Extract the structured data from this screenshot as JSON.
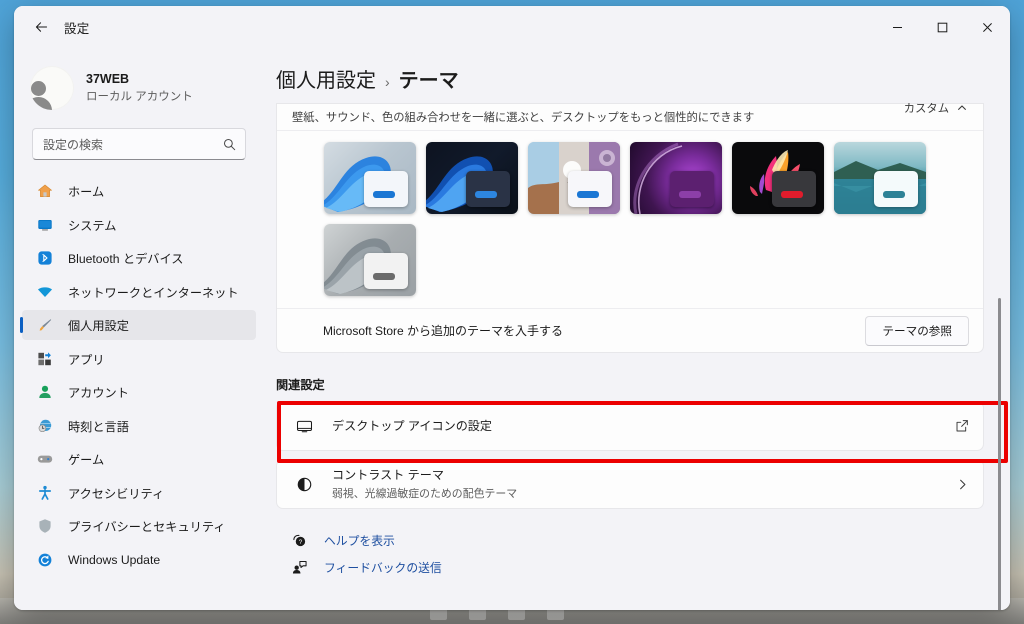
{
  "window": {
    "app_title": "設定",
    "back_icon": "back-arrow-icon",
    "minimize_label": "—",
    "maximize_label": "□",
    "close_label": "✕"
  },
  "sidebar": {
    "account": {
      "name": "37WEB",
      "type": "ローカル アカウント",
      "avatar_icon": "user-avatar-icon"
    },
    "search": {
      "placeholder": "設定の検索",
      "icon": "search-icon"
    },
    "items": [
      {
        "label": "ホーム",
        "icon": "home-icon",
        "selected": false
      },
      {
        "label": "システム",
        "icon": "system-monitor-icon",
        "selected": false
      },
      {
        "label": "Bluetooth とデバイス",
        "icon": "bluetooth-icon",
        "selected": false
      },
      {
        "label": "ネットワークとインターネット",
        "icon": "wifi-icon",
        "selected": false
      },
      {
        "label": "個人用設定",
        "icon": "paintbrush-icon",
        "selected": true
      },
      {
        "label": "アプリ",
        "icon": "apps-icon",
        "selected": false
      },
      {
        "label": "アカウント",
        "icon": "account-person-icon",
        "selected": false
      },
      {
        "label": "時刻と言語",
        "icon": "clock-globe-icon",
        "selected": false
      },
      {
        "label": "ゲーム",
        "icon": "gamepad-icon",
        "selected": false
      },
      {
        "label": "アクセシビリティ",
        "icon": "accessibility-icon",
        "selected": false
      },
      {
        "label": "プライバシーとセキュリティ",
        "icon": "shield-icon",
        "selected": false
      },
      {
        "label": "Windows Update",
        "icon": "update-refresh-icon",
        "selected": false
      }
    ]
  },
  "page": {
    "breadcrumb_parent": "個人用設定",
    "breadcrumb_separator": "›",
    "breadcrumb_current": "テーマ"
  },
  "theme_section": {
    "description": "壁紙、サウンド、色の組み合わせを一緒に選ぶと、デスクトップをもっと個性的にできます",
    "custom_label": "カスタム",
    "custom_chevron_icon": "chevron-up-icon",
    "tiles": [
      {
        "name": "windows-light-bloom-theme"
      },
      {
        "name": "windows-dark-bloom-theme"
      },
      {
        "name": "nature-flower-collage-theme"
      },
      {
        "name": "purple-glow-theme"
      },
      {
        "name": "colorful-flower-dark-theme"
      },
      {
        "name": "teal-lake-landscape-theme"
      },
      {
        "name": "grayscale-bloom-theme"
      }
    ],
    "store_text": "Microsoft Store から追加のテーマを入手する",
    "browse_button": "テーマの参照"
  },
  "related": {
    "heading": "関連設定",
    "rows": [
      {
        "title": "デスクトップ アイコンの設定",
        "subtitle": "",
        "icon": "desktop-monitor-icon",
        "trailing_icon": "external-link-icon",
        "highlighted": true
      },
      {
        "title": "コントラスト テーマ",
        "subtitle": "弱視、光線過敏症のための配色テーマ",
        "icon": "contrast-circle-icon",
        "trailing_icon": "chevron-right-icon",
        "highlighted": false
      }
    ]
  },
  "footer": {
    "links": [
      {
        "label": "ヘルプを表示",
        "icon": "help-question-icon"
      },
      {
        "label": "フィードバックの送信",
        "icon": "feedback-person-icon"
      }
    ]
  },
  "colors": {
    "accent": "#0b5fc2",
    "annotation": "#ec0000",
    "link": "#1e4fa0",
    "page_bg": "#f3f3f7",
    "card_bg": "#fdfdfd"
  }
}
